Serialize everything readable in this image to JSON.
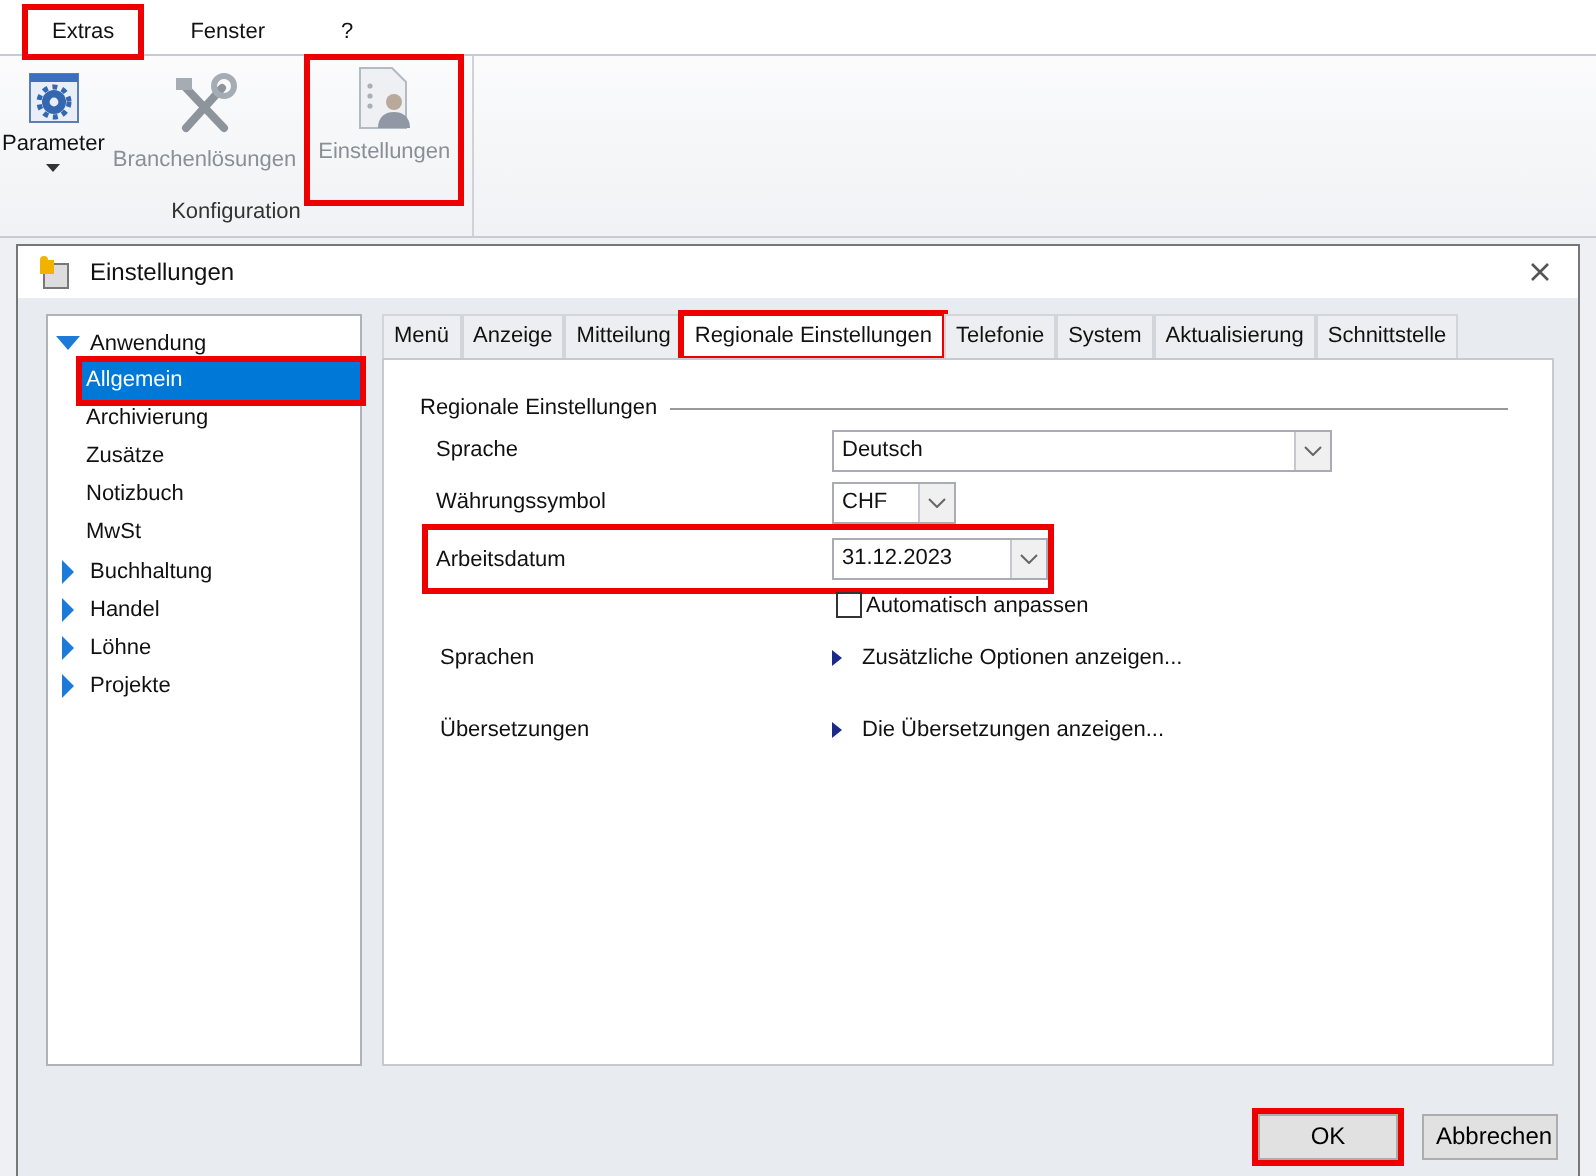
{
  "ribbon": {
    "tabs": [
      {
        "label": "Extras",
        "highlighted": true
      },
      {
        "label": "Fenster",
        "highlighted": false
      },
      {
        "label": "?",
        "highlighted": false
      }
    ],
    "commands": [
      {
        "label": "Parameter",
        "disabled": false,
        "dropdown": true,
        "highlighted": false
      },
      {
        "label": "Branchenlösungen",
        "disabled": true,
        "dropdown": false,
        "highlighted": false
      },
      {
        "label": "Einstellungen",
        "disabled": true,
        "dropdown": false,
        "highlighted": true
      }
    ],
    "group_label": "Konfiguration"
  },
  "dialog": {
    "title": "Einstellungen",
    "tree": [
      {
        "label": "Anwendung",
        "expanded": true,
        "children": [
          {
            "label": "Allgemein",
            "selected": true,
            "highlighted": true
          },
          {
            "label": "Archivierung",
            "selected": false,
            "highlighted": false
          },
          {
            "label": "Zusätze",
            "selected": false,
            "highlighted": false
          },
          {
            "label": "Notizbuch",
            "selected": false,
            "highlighted": false
          },
          {
            "label": "MwSt",
            "selected": false,
            "highlighted": false
          }
        ]
      },
      {
        "label": "Buchhaltung",
        "expanded": false
      },
      {
        "label": "Handel",
        "expanded": false
      },
      {
        "label": "Löhne",
        "expanded": false
      },
      {
        "label": "Projekte",
        "expanded": false
      }
    ],
    "tabs": [
      {
        "label": "Menü",
        "selected": false,
        "highlighted": false
      },
      {
        "label": "Anzeige",
        "selected": false,
        "highlighted": false
      },
      {
        "label": "Mitteilung",
        "selected": false,
        "highlighted": false
      },
      {
        "label": "Regionale Einstellungen",
        "selected": true,
        "highlighted": true
      },
      {
        "label": "Telefonie",
        "selected": false,
        "highlighted": false
      },
      {
        "label": "System",
        "selected": false,
        "highlighted": false
      },
      {
        "label": "Aktualisierung",
        "selected": false,
        "highlighted": false
      },
      {
        "label": "Schnittstelle",
        "selected": false,
        "highlighted": false
      }
    ],
    "group_title": "Regionale Einstellungen",
    "rows": [
      {
        "kind": "select",
        "label": "Sprache",
        "value": "Deutsch",
        "highlighted": false
      },
      {
        "kind": "select",
        "label": "Währungssymbol",
        "value": "CHF",
        "highlighted": false
      },
      {
        "kind": "select",
        "label": "Arbeitsdatum",
        "value": "31.12.2023",
        "highlighted": true
      },
      {
        "kind": "checkbox",
        "label": "Automatisch anpassen",
        "checked": false
      },
      {
        "kind": "link",
        "label": "Sprachen",
        "link": "Zusätzliche Optionen anzeigen..."
      },
      {
        "kind": "link",
        "label": "Übersetzungen",
        "link": "Die Übersetzungen anzeigen..."
      }
    ],
    "buttons": [
      {
        "label": "OK",
        "highlighted": true
      },
      {
        "label": "Abbrechen",
        "highlighted": false
      }
    ]
  }
}
